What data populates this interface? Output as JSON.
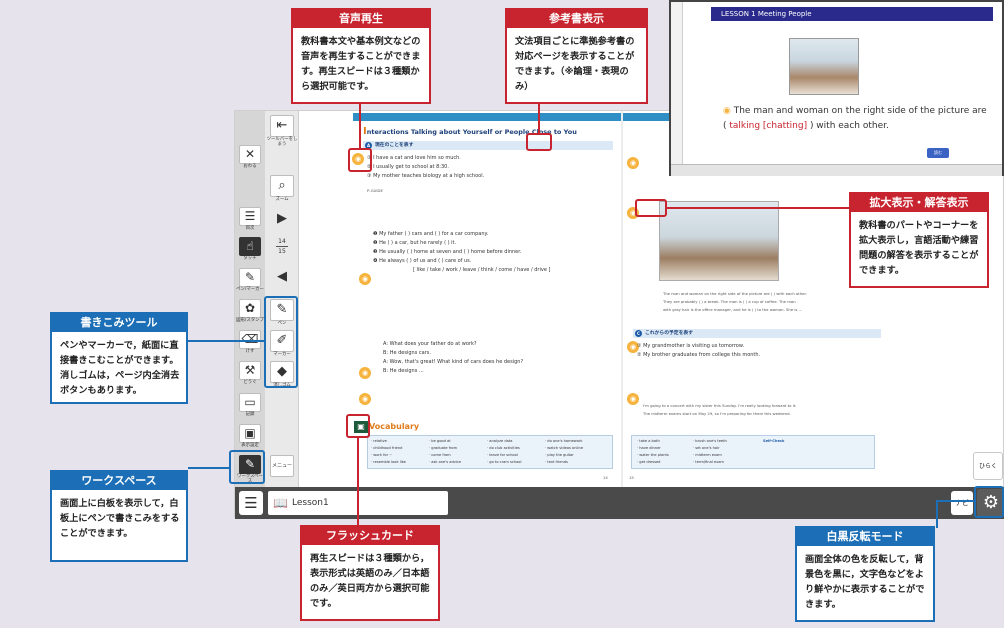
{
  "window": {
    "lesson_tab": "Lesson1",
    "navi": "ナビ",
    "hiraku": "ひらく"
  },
  "left_tools": [
    {
      "name": "owaru",
      "icon": "✕",
      "label": "おわる"
    },
    {
      "name": "mokuji",
      "icon": "☰",
      "label": "目次"
    },
    {
      "name": "touch",
      "icon": "☝",
      "label": "タッチ"
    },
    {
      "name": "pen-marker",
      "icon": "✎",
      "label": "ペン/マーカー"
    },
    {
      "name": "stamp",
      "icon": "✿",
      "label": "図形/スタンプ"
    },
    {
      "name": "kesu",
      "icon": "⌫",
      "label": "けす"
    },
    {
      "name": "dougu",
      "icon": "⚒",
      "label": "どうぐ"
    },
    {
      "name": "kiroku",
      "icon": "▭",
      "label": "記録"
    },
    {
      "name": "hyouji",
      "icon": "▣",
      "label": "表示設定"
    },
    {
      "name": "workspace",
      "icon": "✎",
      "label": "ワークスペース"
    }
  ],
  "nav_tools": {
    "toolbar_hide": "ツールバーをしまう",
    "zoom": "ズーム",
    "page_top": "14",
    "page_bottom": "15",
    "pen": "ペン",
    "marker": "マーカー",
    "eraser": "消しゴム",
    "menu": "メニュー"
  },
  "page_left": {
    "title_big": "I",
    "title": "nteractions  Talking about Yourself or People Close to You",
    "section_a": "現在のことを表す",
    "lines": [
      "① I have a cat and love him so much.",
      "② I usually get to school at 8:30.",
      "③ My mother teaches biology at a high school.",
      "❶ My father (          ) cars and (          ) for a car company.",
      "❷ He (          ) a car, but he rarely (          ) it.",
      "❸ He usually (          ) home at seven and (          ) home before dinner.",
      "❹ He always (          ) of us and (          ) care of us.",
      "[ like / take / work / leave / think / come / have / drive ]",
      "A: What does your father do at work?",
      "B: He designs cars.",
      "A: Wow, that's great! What kind of cars does he design?",
      "B: He designs ..."
    ],
    "vocab_label": "Vocabulary",
    "vocab": [
      "· relative",
      "· childhood friend",
      "· work for ~",
      "· resemble look like",
      "· be good at",
      "· graduate from",
      "· come from",
      "· ask one's advice",
      "· analyze data",
      "· do club activities",
      "· leave for school",
      "· go to cram school",
      "· do one's homework",
      "· watch videos online",
      "· play the guitar",
      "· text friends"
    ],
    "page_number": "14"
  },
  "page_right": {
    "caption_lines": [
      "The man and woman on the right side of the picture are (          ) with each other.",
      "They are probably (          ) a break. The man is (          ) a cup of coffee. The man",
      "with gray hair is the office manager, and he is (          ) to the woman. She is ..."
    ],
    "section_c": "これからの予定を表す",
    "c_lines": [
      "① My grandmother is visiting us tomorrow.",
      "② My brother graduates from college this month.",
      "I'm going to a concert with my sister this Sunday. I'm really looking forward to it.",
      "The midterm exams start on May 29, so I'm preparing for them this weekend."
    ],
    "vocab": [
      "· take a bath",
      "· have dinner",
      "· water the plants",
      "· get dressed",
      "· brush one's teeth",
      "· set one's hair",
      "· midterm exam",
      "· term/final exam"
    ],
    "self_check": "Self-Check",
    "page_number": "15"
  },
  "popup": {
    "title": "LESSON 1  Meeting People",
    "text_before": "The man and woman on the right side of the picture are (",
    "text_answer": " talking [chatting] ",
    "text_after": ") with each other.",
    "button": "読む"
  },
  "callouts": {
    "audio": {
      "title": "音声再生",
      "body": "教科書本文や基本例文などの音声を再生することができます。再生スピードは３種類から選択可能です。"
    },
    "reference": {
      "title": "参考書表示",
      "body": "文法項目ごとに準拠参考書の対応ページを表示することができます。（※論理・表現のみ）"
    },
    "zoom": {
      "title": "拡大表示・解答表示",
      "body": "教科書のパートやコーナーを拡大表示し，言語活動や練習問題の解答を表示することができます。"
    },
    "writing": {
      "title": "書きこみツール",
      "body": "ペンやマーカーで，紙面に直接書きこむことができます。消しゴムは，ページ内全消去ボタンもあります。"
    },
    "workspace": {
      "title": "ワークスペース",
      "body": "画面上に白板を表示して，白板上にペンで書きこみをすることができます。"
    },
    "flashcard": {
      "title": "フラッシュカード",
      "body": "再生スピードは３種類から，表示形式は英語のみ／日本語のみ／英日両方から選択可能です。"
    },
    "contrast": {
      "title": "白黒反転モード",
      "body": "画面全体の色を反転して，背景色を黒に，文字色などをより鮮やかに表示することができます。"
    }
  }
}
